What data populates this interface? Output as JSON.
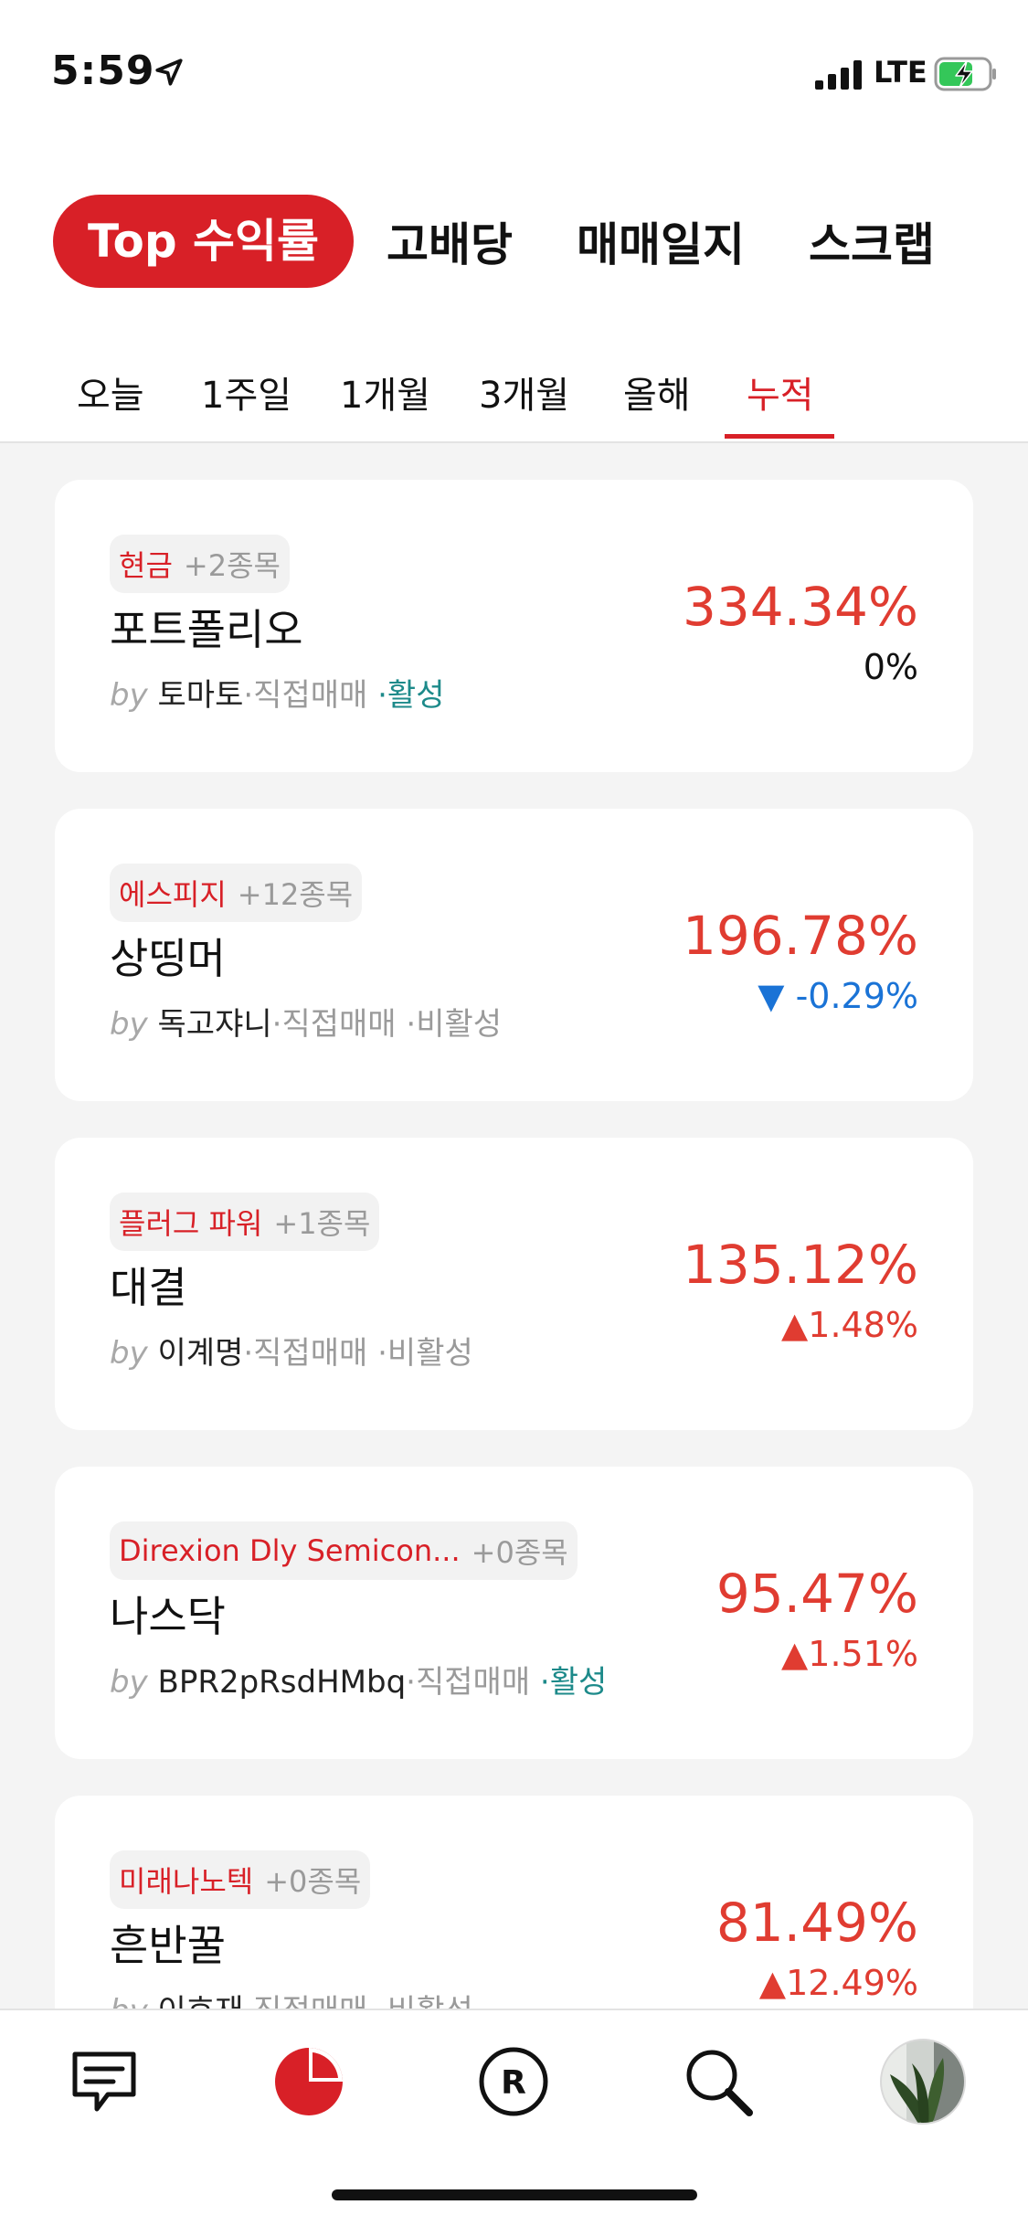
{
  "status_bar": {
    "time": "5:59",
    "network": "LTE"
  },
  "main_tabs": [
    {
      "label": "Top 수익률",
      "active": true
    },
    {
      "label": "고배당",
      "active": false
    },
    {
      "label": "매매일지",
      "active": false
    },
    {
      "label": "스크랩",
      "active": false
    }
  ],
  "period_tabs": [
    {
      "label": "오늘",
      "active": false
    },
    {
      "label": "1주일",
      "active": false
    },
    {
      "label": "1개월",
      "active": false
    },
    {
      "label": "3개월",
      "active": false
    },
    {
      "label": "올해",
      "active": false
    },
    {
      "label": "누적",
      "active": true
    }
  ],
  "portfolios": [
    {
      "top_holding": "현금",
      "extra_count": "+2종목",
      "name": "포트폴리오",
      "by": "by",
      "owner": "토마토",
      "trade_type": "·직접매매",
      "status": "·활성",
      "status_active": true,
      "return": "334.34%",
      "change": "0%",
      "direction": "neutral",
      "arrow": ""
    },
    {
      "top_holding": "에스피지",
      "extra_count": "+12종목",
      "name": "상띵머",
      "by": "by",
      "owner": "독고쟈니",
      "trade_type": "·직접매매",
      "status": "·비활성",
      "status_active": false,
      "return": "196.78%",
      "change": "-0.29%",
      "direction": "down",
      "arrow": "▼"
    },
    {
      "top_holding": "플러그 파워",
      "extra_count": "+1종목",
      "name": "대결",
      "by": "by",
      "owner": "이계명",
      "trade_type": "·직접매매",
      "status": "·비활성",
      "status_active": false,
      "return": "135.12%",
      "change": "1.48%",
      "direction": "up",
      "arrow": "▲"
    },
    {
      "top_holding": "Direxion Dly Semicon...",
      "extra_count": "+0종목",
      "name": "나스닥",
      "by": "by",
      "owner": "BPR2pRsdHMbq",
      "trade_type": "·직접매매",
      "status": "·활성",
      "status_active": true,
      "return": "95.47%",
      "change": "1.51%",
      "direction": "up",
      "arrow": "▲"
    },
    {
      "top_holding": "미래나노텍",
      "extra_count": "+0종목",
      "name": "흔반꿀",
      "by": "by",
      "owner": "이호재",
      "trade_type": "·직접매매",
      "status": "·비활성",
      "status_active": false,
      "return": "81.49%",
      "change": "12.49%",
      "direction": "up",
      "arrow": "▲"
    }
  ],
  "bottom_nav": [
    {
      "icon": "chat-icon",
      "active": false
    },
    {
      "icon": "portfolio-pie-icon",
      "active": true
    },
    {
      "icon": "r-circle-icon",
      "active": false
    },
    {
      "icon": "search-icon",
      "active": false
    },
    {
      "icon": "profile-avatar",
      "active": false
    }
  ],
  "colors": {
    "accent": "#d82027",
    "positive": "#e03c31",
    "negative": "#1a73d6",
    "active_status": "#1d8a8a"
  }
}
